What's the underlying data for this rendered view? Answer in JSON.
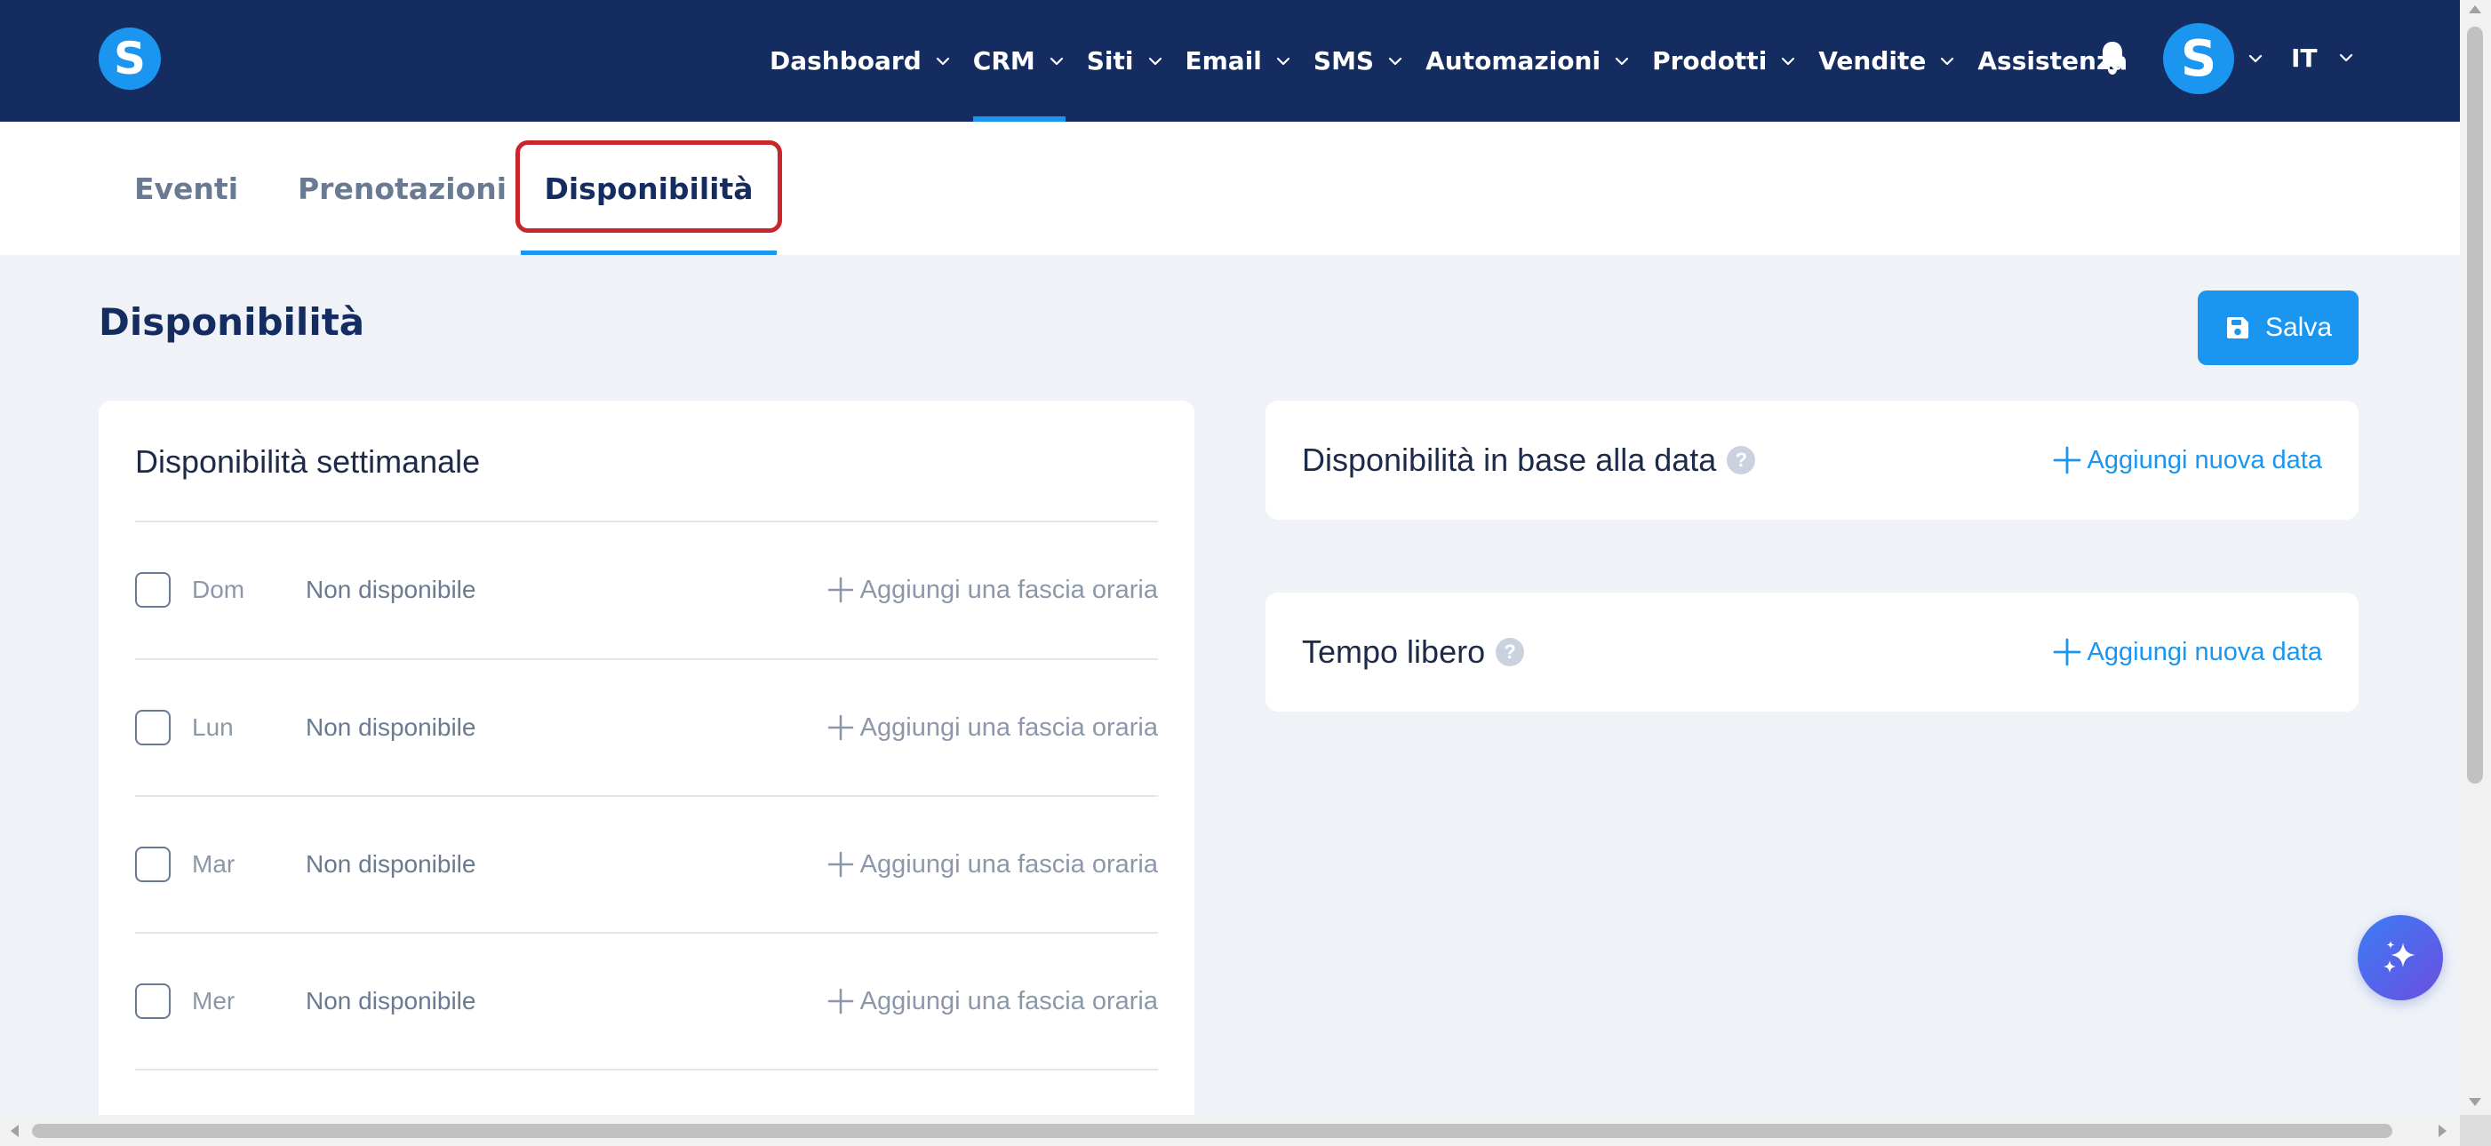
{
  "brand": {
    "logo_letter": "S"
  },
  "nav": {
    "items": [
      {
        "label": "Dashboard",
        "has_dropdown": true
      },
      {
        "label": "CRM",
        "has_dropdown": true,
        "active": true
      },
      {
        "label": "Siti",
        "has_dropdown": true
      },
      {
        "label": "Email",
        "has_dropdown": true
      },
      {
        "label": "SMS",
        "has_dropdown": true
      },
      {
        "label": "Automazioni",
        "has_dropdown": true
      },
      {
        "label": "Prodotti",
        "has_dropdown": true
      },
      {
        "label": "Vendite",
        "has_dropdown": true
      },
      {
        "label": "Assistenza",
        "has_dropdown": false
      }
    ],
    "bell_icon": "bell-icon",
    "avatar_letter": "S",
    "language": "IT"
  },
  "tabs": [
    {
      "label": "Eventi",
      "active": false
    },
    {
      "label": "Prenotazioni",
      "active": false
    },
    {
      "label": "Disponibilità",
      "active": true
    }
  ],
  "page": {
    "title": "Disponibilità",
    "save_label": "Salva"
  },
  "weekly": {
    "title": "Disponibilità settimanale",
    "days": [
      {
        "day": "Dom",
        "status": "Non disponibile",
        "action": "Aggiungi una fascia oraria",
        "checked": false
      },
      {
        "day": "Lun",
        "status": "Non disponibile",
        "action": "Aggiungi una fascia oraria",
        "checked": false
      },
      {
        "day": "Mar",
        "status": "Non disponibile",
        "action": "Aggiungi una fascia oraria",
        "checked": false
      },
      {
        "day": "Mer",
        "status": "Non disponibile",
        "action": "Aggiungi una fascia oraria",
        "checked": false
      }
    ]
  },
  "date_availability": {
    "title": "Disponibilità in base alla data",
    "help": "?",
    "action": "Aggiungi nuova data"
  },
  "free_time": {
    "title": "Tempo libero",
    "help": "?",
    "action": "Aggiungi nuova data"
  },
  "colors": {
    "nav_bg": "#142c5f",
    "accent": "#1a96f0",
    "highlight": "#c8262a",
    "page_bg": "#eff3f8"
  }
}
